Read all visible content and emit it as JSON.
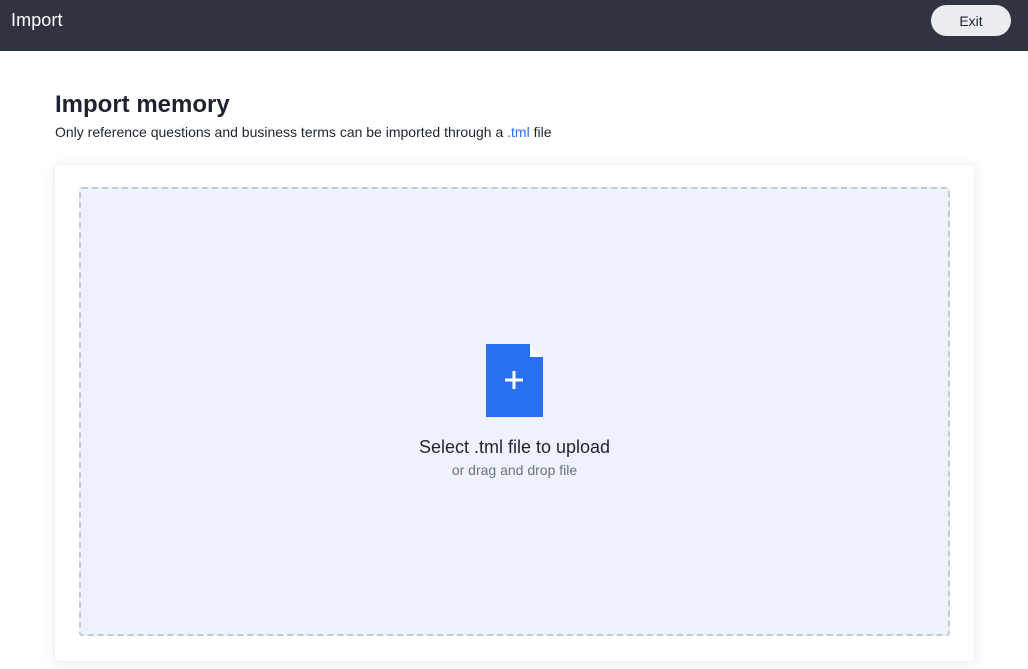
{
  "header": {
    "title": "Import",
    "exit_label": "Exit"
  },
  "main": {
    "title": "Import memory",
    "subtitle_before": "Only reference questions and business terms can be imported through a ",
    "subtitle_link": ".tml",
    "subtitle_after": " file"
  },
  "dropzone": {
    "icon": "file-plus-icon",
    "title": "Select .tml file to upload",
    "hint": "or drag and drop file"
  },
  "colors": {
    "header_bg": "#2f3440",
    "accent": "#2770ef",
    "dropzone_bg": "#eef2fd"
  }
}
